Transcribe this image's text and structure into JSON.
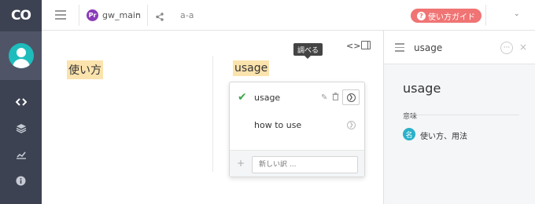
{
  "app": {
    "logo": "CO"
  },
  "leftnav": {
    "icons": [
      "code-icon",
      "layers-icon",
      "chart-icon",
      "info-icon"
    ]
  },
  "topbar": {
    "project_badge": "Pr",
    "project_name": "gw_main",
    "breadcrumb": "a-a",
    "guide_label": "使い方ガイド"
  },
  "editor": {
    "source_text": "使い方",
    "target_text": "usage"
  },
  "suggestions": {
    "tooltip": "調べる",
    "items": [
      {
        "text": "usage",
        "selected": true
      },
      {
        "text": "how to use",
        "selected": false
      }
    ],
    "new_placeholder": "新しい訳 ..."
  },
  "sidepanel": {
    "title": "usage",
    "word": "usage",
    "meaning_label": "意味",
    "pos_badge": "名",
    "meaning": "使い方、用法"
  },
  "colors": {
    "leftbar": "#3d4252",
    "accent_guide": "#f07474",
    "highlight": "#fbe3ad",
    "check": "#3ea84a",
    "pos_badge": "#2ab1c9"
  }
}
